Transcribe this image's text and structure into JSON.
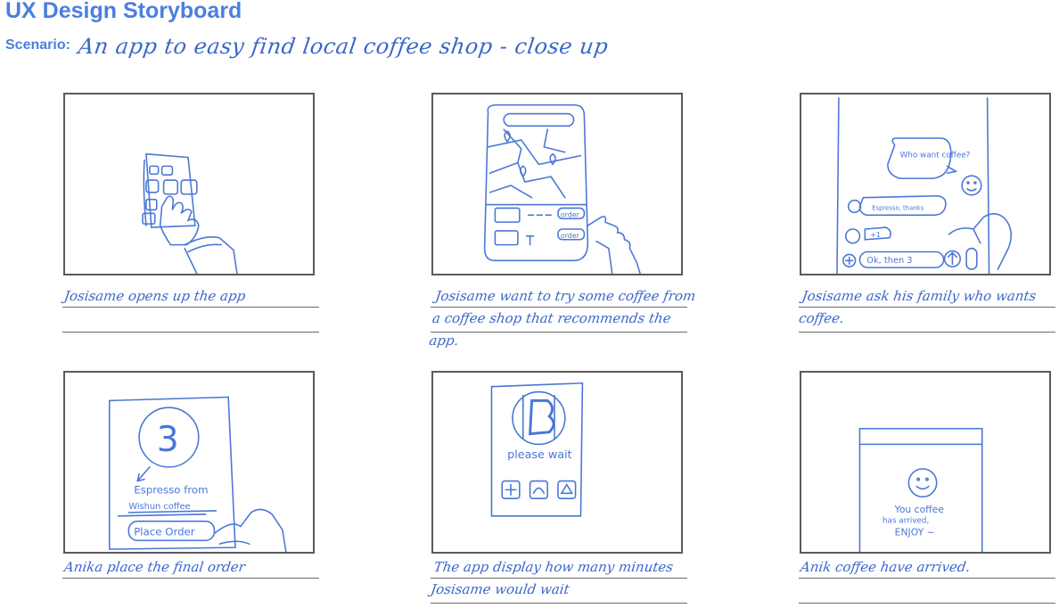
{
  "header": {
    "title": "UX Design Storyboard",
    "scenario_label": "Scenario:",
    "scenario_text": "An app to easy find local coffee shop - close up"
  },
  "panels": [
    {
      "caption": "Josisame opens up the app"
    },
    {
      "caption": "Josisame want to try some coffee from a coffee shop that recommends the app.",
      "labels": {
        "order1": "order",
        "order2": "order"
      }
    },
    {
      "caption": "Josisame ask his family who wants coffee.",
      "labels": {
        "bubble": "Who want coffee?",
        "reply1": "Espresso, thanks",
        "reply2": "+1",
        "input": "Ok, then 3"
      }
    },
    {
      "caption": "Anika place the final order",
      "labels": {
        "count": "3",
        "line1": "Espresso from",
        "line2": "Wishun coffee",
        "button": "Place Order"
      }
    },
    {
      "caption": "The app display how many minutes Josisame would wait",
      "labels": {
        "wait": "please wait"
      }
    },
    {
      "caption": "Anik coffee have arrived.",
      "labels": {
        "line1": "You coffee",
        "line2": "has arrived,",
        "line3": "ENJOY ~"
      }
    }
  ]
}
